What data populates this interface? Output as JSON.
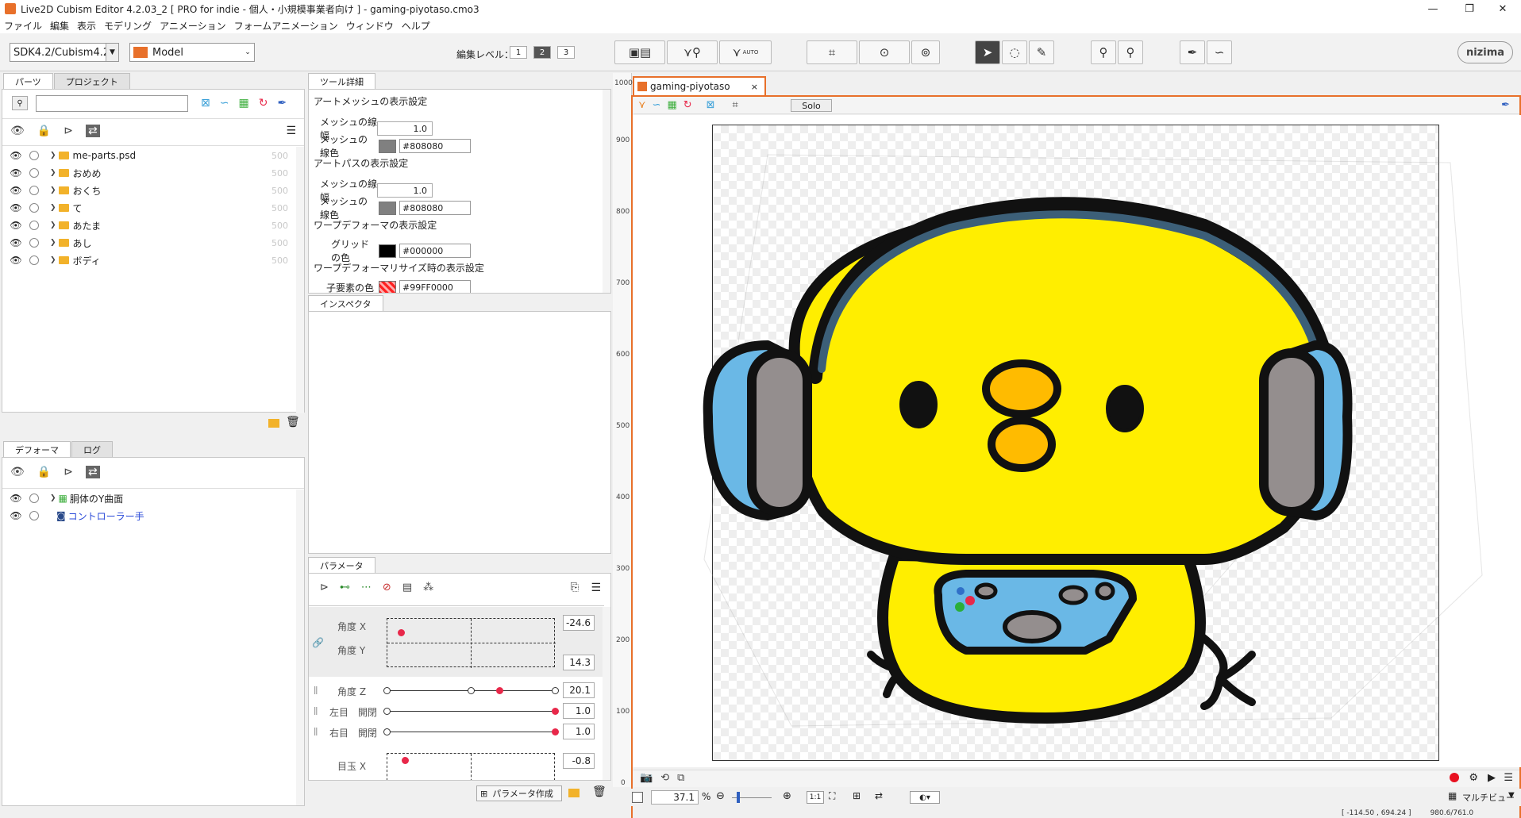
{
  "window": {
    "title": "Live2D Cubism Editor 4.2.03_2   [ PRO for indie - 個人・小規模事業者向け ] - gaming-piyotaso.cmo3",
    "minimize": "—",
    "maximize": "❐",
    "close": "✕"
  },
  "menu": [
    "ファイル",
    "編集",
    "表示",
    "モデリング",
    "アニメーション",
    "フォームアニメーション",
    "ウィンドウ",
    "ヘルプ"
  ],
  "toolbar": {
    "sdk_select": "SDK4.2/Cubism4.2",
    "mode_select": "Model",
    "edit_level_label": "編集レベル：",
    "edit_levels": [
      "1",
      "2",
      "3"
    ],
    "auto_label": "AUTO",
    "brand": "nizima"
  },
  "parts_panel": {
    "tabs": [
      "パーツ",
      "プロジェクト"
    ],
    "search_placeholder": "",
    "items": [
      {
        "label": "me-parts.psd",
        "value": "500"
      },
      {
        "label": "おめめ",
        "value": "500"
      },
      {
        "label": "おくち",
        "value": "500"
      },
      {
        "label": "て",
        "value": "500"
      },
      {
        "label": "あたま",
        "value": "500"
      },
      {
        "label": "あし",
        "value": "500"
      },
      {
        "label": "ボディ",
        "value": "500"
      }
    ]
  },
  "deformer_panel": {
    "tabs": [
      "デフォーマ",
      "ログ"
    ],
    "items": [
      {
        "label": "胴体のY曲面"
      },
      {
        "label": "コントローラー手"
      }
    ]
  },
  "tool_detail": {
    "tab": "ツール詳細",
    "sections": [
      {
        "title": "アートメッシュの表示設定",
        "rows": [
          {
            "label": "メッシュの線幅",
            "value": "1.0"
          },
          {
            "label": "メッシュの線色",
            "hex": "#808080",
            "color": "#808080"
          }
        ]
      },
      {
        "title": "アートパスの表示設定",
        "rows": [
          {
            "label": "メッシュの線幅",
            "value": "1.0"
          },
          {
            "label": "メッシュの線色",
            "hex": "#808080",
            "color": "#808080"
          }
        ]
      },
      {
        "title": "ワープデフォーマの表示設定",
        "rows": [
          {
            "label": "グリッドの色",
            "hex": "#000000",
            "color": "#000000"
          }
        ]
      },
      {
        "title": "ワープデフォーマリサイズ時の表示設定",
        "rows": [
          {
            "label": "子要素の色",
            "hex": "#99FF0000",
            "color": "#ff2020"
          }
        ]
      }
    ]
  },
  "inspector": {
    "tab": "インスペクタ"
  },
  "parameters": {
    "tab": "パラメータ",
    "xy": {
      "label_x": "角度 X",
      "label_y": "角度 Y",
      "value_x": "-24.6",
      "value_y": "14.3",
      "fx": 0.08,
      "fy": 0.27
    },
    "rows": [
      {
        "label": "角度 Z",
        "value": "20.1",
        "fraction": 0.67
      },
      {
        "label": "左目　開閉",
        "value": "1.0",
        "fraction": 1.0
      },
      {
        "label": "右目　開閉",
        "value": "1.0",
        "fraction": 1.0
      }
    ],
    "eye_x": {
      "label": "目玉 X",
      "value": "-0.8"
    },
    "create_button": "パラメータ作成"
  },
  "viewport": {
    "tab": "gaming-piyotaso",
    "tab_close": "×",
    "solo": "Solo",
    "ruler": [
      "1000",
      "900",
      "800",
      "700",
      "600",
      "500",
      "400",
      "300",
      "200",
      "100",
      "0"
    ],
    "zoom": "37.1",
    "zoom_unit": "%",
    "ratio_button": "1:1",
    "multiview": "マルチビュー",
    "coords": "[ -114.50 , 694.24 ]",
    "coords2": "980.6/761.0"
  },
  "colors": {
    "accent": "#e8702a",
    "yellow": "#ffee00",
    "blue": "#6ab8e6",
    "gray": "#948e8e",
    "orange": "#ffbb00",
    "outline": "#111111",
    "helmet": "#3c5f78"
  }
}
